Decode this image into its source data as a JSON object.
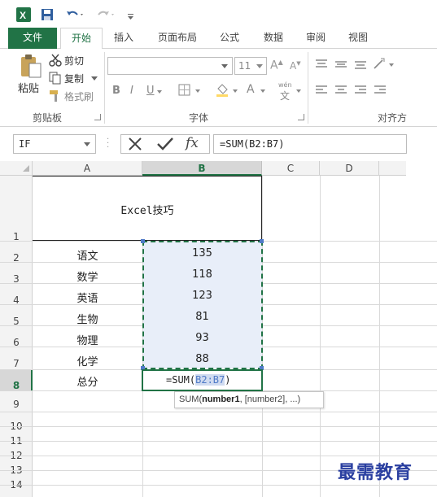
{
  "qat": {
    "undo_icon": "undo-icon",
    "redo_icon": "redo-icon"
  },
  "tabs": [
    "文件",
    "开始",
    "插入",
    "页面布局",
    "公式",
    "数据",
    "审阅",
    "视图"
  ],
  "ribbon": {
    "paste": "粘贴",
    "cut": "剪切",
    "copy": "复制",
    "format_painter": "格式刷",
    "clipboard_group": "剪贴板",
    "font_size": "11",
    "bold": "B",
    "italic": "I",
    "underline": "U",
    "font_color_letter": "A",
    "wen": "wén",
    "wen_char": "文",
    "font_group": "字体",
    "align_group": "对齐方"
  },
  "formula_bar": {
    "name_box": "IF",
    "formula": "=SUM(B2:B7)",
    "fx": "fx"
  },
  "columns": [
    "A",
    "B",
    "C",
    "D"
  ],
  "rows": [
    "1",
    "2",
    "3",
    "4",
    "5",
    "6",
    "7",
    "8",
    "9",
    "10",
    "11",
    "12",
    "13",
    "14"
  ],
  "sheet": {
    "title": "Excel技巧",
    "subjects": [
      "语文",
      "数学",
      "英语",
      "生物",
      "物理",
      "化学"
    ],
    "scores": [
      "135",
      "118",
      "123",
      "81",
      "93",
      "88"
    ],
    "total_label": "总分",
    "edit_prefix": "=SUM(",
    "edit_ref": "B2:B7",
    "edit_suffix": ")"
  },
  "tooltip": {
    "fn": "SUM(",
    "arg1": "number1",
    "rest": ", [number2], ...)"
  },
  "watermark": "最需教育",
  "colors": {
    "accent": "#217346",
    "selection": "#e8eef9",
    "marquee": "#217346",
    "ref": "#4f7ac7"
  }
}
